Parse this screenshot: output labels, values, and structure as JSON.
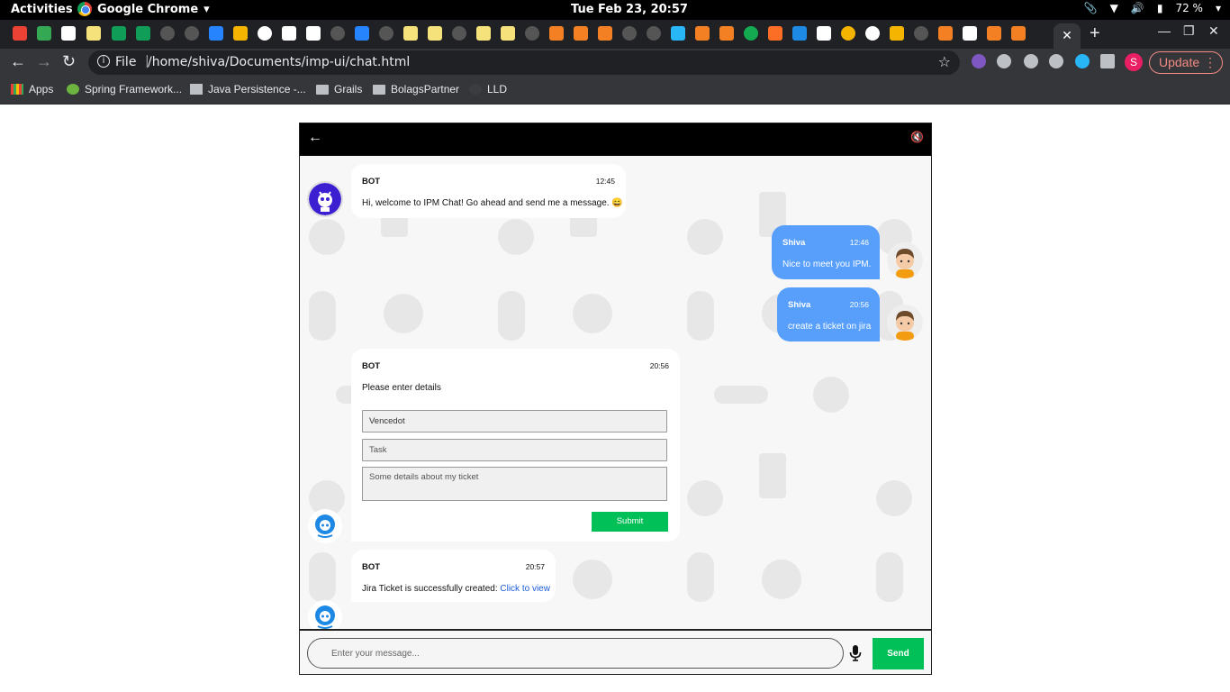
{
  "system_bar": {
    "activities": "Activities",
    "app_name": "Google Chrome",
    "clock": "Tue Feb 23, 20:57",
    "battery": "72 %"
  },
  "browser": {
    "address": {
      "scheme": "File",
      "url": "/home/shiva/Documents/imp-ui/chat.html"
    },
    "update_label": "Update",
    "profile_initial": "S",
    "bookmarks": [
      {
        "label": "Apps"
      },
      {
        "label": "Spring Framework..."
      },
      {
        "label": "Java Persistence -..."
      },
      {
        "label": "Grails"
      },
      {
        "label": "BolagsPartner"
      },
      {
        "label": "LLD"
      }
    ]
  },
  "chat": {
    "messages": [
      {
        "sender": "BOT",
        "time": "12:45",
        "text": "Hi, welcome to IPM Chat! Go ahead and send me a message. 😄"
      },
      {
        "sender": "Shiva",
        "time": "12:46",
        "text": "Nice to meet you IPM."
      },
      {
        "sender": "Shiva",
        "time": "20:56",
        "text": "create a ticket on jira"
      },
      {
        "sender": "BOT",
        "time": "20:56",
        "text": "Please enter details",
        "form": {
          "project_value": "Vencedot",
          "task_placeholder": "Task",
          "details_placeholder": "Some details about my ticket",
          "submit_label": "Submit"
        }
      },
      {
        "sender": "BOT",
        "time": "20:57",
        "text": "Jira Ticket is successfully created: ",
        "link": "Click to view"
      }
    ],
    "input_placeholder": "Enter your message...",
    "send_label": "Send"
  }
}
